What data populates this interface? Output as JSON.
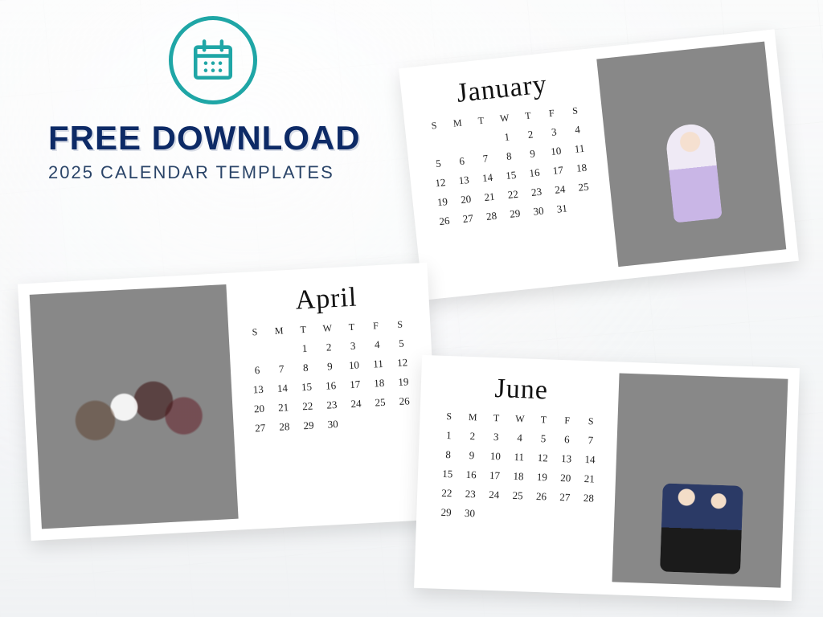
{
  "header": {
    "headline": "FREE DOWNLOAD",
    "subline": "2025 CALENDAR TEMPLATES"
  },
  "colors": {
    "accent_teal": "#1fa6a6",
    "headline_navy": "#0d2a66"
  },
  "dow": [
    "S",
    "M",
    "T",
    "W",
    "T",
    "F",
    "S"
  ],
  "cards": {
    "january": {
      "title": "January",
      "weeks": [
        [
          "",
          "",
          "",
          "1",
          "2",
          "3",
          "4"
        ],
        [
          "5",
          "6",
          "7",
          "8",
          "9",
          "10",
          "11"
        ],
        [
          "12",
          "13",
          "14",
          "15",
          "16",
          "17",
          "18"
        ],
        [
          "19",
          "20",
          "21",
          "22",
          "23",
          "24",
          "25"
        ],
        [
          "26",
          "27",
          "28",
          "29",
          "30",
          "31",
          ""
        ]
      ]
    },
    "april": {
      "title": "April",
      "weeks": [
        [
          "",
          "",
          "1",
          "2",
          "3",
          "4",
          "5"
        ],
        [
          "6",
          "7",
          "8",
          "9",
          "10",
          "11",
          "12"
        ],
        [
          "13",
          "14",
          "15",
          "16",
          "17",
          "18",
          "19"
        ],
        [
          "20",
          "21",
          "22",
          "23",
          "24",
          "25",
          "26"
        ],
        [
          "27",
          "28",
          "29",
          "30",
          "",
          "",
          ""
        ]
      ]
    },
    "june": {
      "title": "June",
      "weeks": [
        [
          "1",
          "2",
          "3",
          "4",
          "5",
          "6",
          "7"
        ],
        [
          "8",
          "9",
          "10",
          "11",
          "12",
          "13",
          "14"
        ],
        [
          "15",
          "16",
          "17",
          "18",
          "19",
          "20",
          "21"
        ],
        [
          "22",
          "23",
          "24",
          "25",
          "26",
          "27",
          "28"
        ],
        [
          "29",
          "30",
          "",
          "",
          "",
          "",
          ""
        ]
      ]
    }
  }
}
